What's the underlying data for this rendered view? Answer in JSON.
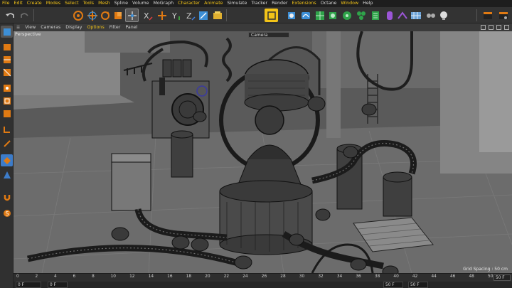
{
  "menu": [
    "File",
    "Edit",
    "Create",
    "Modes",
    "Select",
    "Tools",
    "Mesh",
    "Spline",
    "Volume",
    "MoGraph",
    "Character",
    "Animate",
    "Simulate",
    "Tracker",
    "Render",
    "Extensions",
    "Octane",
    "Window",
    "Help"
  ],
  "menu_highlight": [
    "File",
    "Edit",
    "Create",
    "Modes",
    "Select",
    "Tools",
    "Mesh",
    "Character",
    "Animate",
    "Extensions",
    "Window"
  ],
  "viewport_menu": [
    "View",
    "Cameras",
    "Display",
    "Options",
    "Filter",
    "Panel"
  ],
  "viewport_menu_active": "Options",
  "viewport": {
    "label": "Perspective",
    "camera": "Camera",
    "grid_spacing": "Grid Spacing : 50 cm"
  },
  "timeline": {
    "ticks": [
      "0",
      "2",
      "4",
      "6",
      "8",
      "10",
      "12",
      "14",
      "16",
      "18",
      "20",
      "22",
      "24",
      "26",
      "28",
      "30",
      "32",
      "34",
      "36",
      "38",
      "40",
      "42",
      "44",
      "46",
      "48",
      "50"
    ],
    "end_label": "50 F",
    "start_field": "0 F",
    "min_field": "0 F",
    "max_field": "50 F",
    "max2_field": "50 F"
  },
  "colors": {
    "accent": "#f2c318",
    "render_orange": "#e07a13",
    "cube_blue": "#3d8fd6",
    "green": "#2fa34a"
  }
}
